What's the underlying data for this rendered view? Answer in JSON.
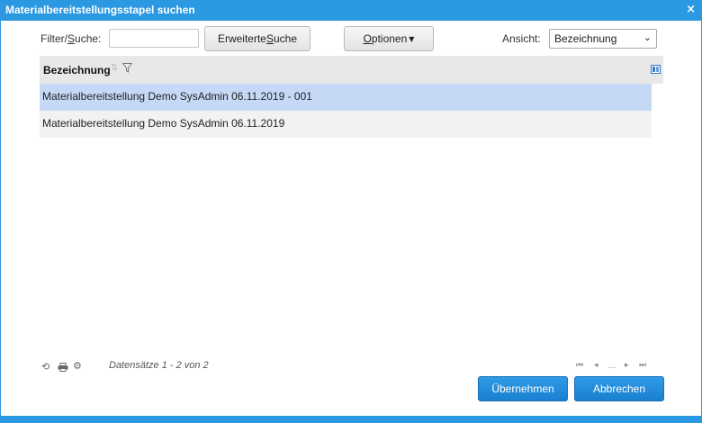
{
  "dialog": {
    "title": "Materialbereitstellungsstapel suchen",
    "close_glyph": "×"
  },
  "toolbar": {
    "filter_label_pre": "Filter/",
    "filter_label_u": "S",
    "filter_label_post": "uche:",
    "filter_value": "",
    "advanced_pre": "Erweiterte ",
    "advanced_u": "S",
    "advanced_post": "uche",
    "options_u": "O",
    "options_post": "ptionen",
    "view_label": "Ansicht:",
    "view_value": "Bezeichnung"
  },
  "grid": {
    "column": "Bezeichnung",
    "rows": [
      "Materialbereitstellung Demo SysAdmin 06.11.2019 - 001",
      "Materialbereitstellung Demo SysAdmin 06.11.2019"
    ]
  },
  "footer": {
    "status": "Datensätze 1 - 2 von 2",
    "pager_ellipsis": "..."
  },
  "buttons": {
    "accept": "Übernehmen",
    "cancel": "Abbrechen"
  },
  "colors": {
    "accent": "#2b98e2",
    "selected_row": "#c5d9f7"
  },
  "icons": [
    "close-icon",
    "caret-down-icon",
    "chevron-down-icon",
    "sort-icon",
    "filter-icon",
    "column-chooser-icon",
    "refresh-icon",
    "print-icon",
    "settings-icon",
    "first-page-icon",
    "prev-page-icon",
    "next-page-icon",
    "last-page-icon"
  ]
}
